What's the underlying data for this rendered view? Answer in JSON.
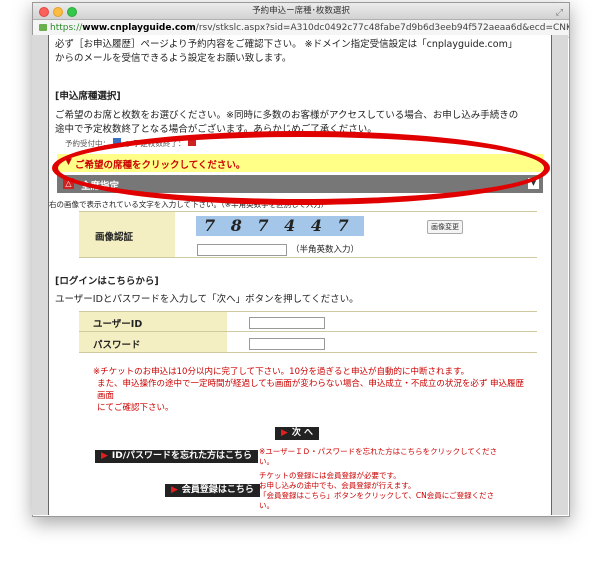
{
  "window": {
    "title": "予約申込ー席種･枚数選択",
    "url_proto": "https://",
    "url_host": "www.cnplayguide.com",
    "url_rest": "/rsv/stkslc.aspx?sid=A310dc0492c77c48fabe7d9b6d3eeb94f572aeaa6d&ecd=CNK..."
  },
  "intro": {
    "line1": "必ず［お申込履歴］ページより予約内容をご確認下さい。 ※ドメイン指定受信設定は「cnplayguide.com」",
    "line2": "からのメールを受信できるよう設定をお願い致します。"
  },
  "seat_section": {
    "heading": "[申込席種選択]",
    "desc1": "ご希望のお席と枚数をお選びください。※同時に多数のお客様がアクセスしている場合、お申し込み手続きの",
    "desc2": "途中で予定枚数終了となる場合がございます。あらかじめご了承ください。",
    "legend_prefix": "予約受付中：",
    "legend_rest": "○ 予定枚数終了：",
    "select_prompt": "ご希望の席種をクリックしてください。",
    "seat_option": "全席指定"
  },
  "captcha": {
    "instruction": "右の画像で表示されている文字を入力して下さい。（※半角英数字を区別して入力）",
    "label": "画像認証",
    "image_text": "7 8 7 4 4 7",
    "change_button": "画像変更",
    "hint": "（半角英数入力）"
  },
  "login": {
    "heading": "[ログインはこちらから]",
    "desc": "ユーザーIDとパスワードを入力して「次へ」ボタンを押してください。",
    "user_label": "ユーザーID",
    "pass_label": "パスワード"
  },
  "notes": {
    "line1": "※チケットのお申込は10分以内に完了して下さい。10分を過ぎると申込が自動的に中断されます。",
    "line2": "また、申込操作の途中で一定時間が経過しても画面が変わらない場合、申込成立・不成立の状況を必ず 申込履歴",
    "line3": "画面",
    "line4": "にてご確認下さい。"
  },
  "buttons": {
    "next": "次 へ",
    "forgot": "ID/パスワードを忘れた方はこちら",
    "register": "会員登録はこちら"
  },
  "side_notes": {
    "forgot_1": "※ユーザーＩＤ・パスワードを忘れた方はこちらをクリックしてくださ",
    "forgot_2": "い。",
    "reg_1": "チケットの登録には会員登録が必要です。",
    "reg_2": "お申し込みの途中でも、会員登録が行えます。",
    "reg_3": "「会員登録はこちら」ボタンをクリックして、CN会員にご登録くださ",
    "reg_4": "い。"
  },
  "colors": {
    "highlight_ring": "#e00000",
    "prompt_bar": "#ffff88",
    "seat_bar": "#777777",
    "form_cell": "#f3efc2"
  }
}
